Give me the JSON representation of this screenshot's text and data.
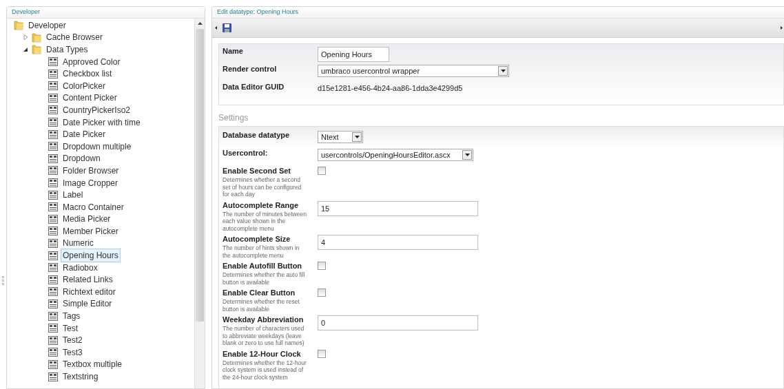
{
  "left_panel": {
    "title": "Developer",
    "tree": [
      {
        "label": "Developer",
        "kind": "folder",
        "selected": false,
        "children": [
          {
            "label": "Cache Browser",
            "kind": "folder",
            "expanded": false,
            "selected": false
          },
          {
            "label": "Data Types",
            "kind": "folder",
            "expanded": true,
            "selected": false,
            "children": [
              {
                "label": "Approved Color",
                "kind": "datatype",
                "selected": false
              },
              {
                "label": "Checkbox list",
                "kind": "datatype",
                "selected": false
              },
              {
                "label": "ColorPicker",
                "kind": "datatype",
                "selected": false
              },
              {
                "label": "Content Picker",
                "kind": "datatype",
                "selected": false
              },
              {
                "label": "CountryPickerIso2",
                "kind": "datatype",
                "selected": false
              },
              {
                "label": "Date Picker with time",
                "kind": "datatype",
                "selected": false
              },
              {
                "label": "Date Picker",
                "kind": "datatype",
                "selected": false
              },
              {
                "label": "Dropdown multiple",
                "kind": "datatype",
                "selected": false
              },
              {
                "label": "Dropdown",
                "kind": "datatype",
                "selected": false
              },
              {
                "label": "Folder Browser",
                "kind": "datatype",
                "selected": false
              },
              {
                "label": "Image Cropper",
                "kind": "datatype",
                "selected": false
              },
              {
                "label": "Label",
                "kind": "datatype",
                "selected": false
              },
              {
                "label": "Macro Container",
                "kind": "datatype",
                "selected": false
              },
              {
                "label": "Media Picker",
                "kind": "datatype",
                "selected": false
              },
              {
                "label": "Member Picker",
                "kind": "datatype",
                "selected": false
              },
              {
                "label": "Numeric",
                "kind": "datatype",
                "selected": false
              },
              {
                "label": "Opening Hours",
                "kind": "datatype",
                "selected": true
              },
              {
                "label": "Radiobox",
                "kind": "datatype",
                "selected": false
              },
              {
                "label": "Related Links",
                "kind": "datatype",
                "selected": false
              },
              {
                "label": "Richtext editor",
                "kind": "datatype",
                "selected": false
              },
              {
                "label": "Simple Editor",
                "kind": "datatype",
                "selected": false
              },
              {
                "label": "Tags",
                "kind": "datatype",
                "selected": false
              },
              {
                "label": "Test",
                "kind": "datatype",
                "selected": false
              },
              {
                "label": "Test2",
                "kind": "datatype",
                "selected": false
              },
              {
                "label": "Test3",
                "kind": "datatype",
                "selected": false
              },
              {
                "label": "Textbox multiple",
                "kind": "datatype",
                "selected": false
              },
              {
                "label": "Textstring",
                "kind": "datatype",
                "selected": false
              }
            ]
          }
        ]
      }
    ]
  },
  "editor": {
    "title": "Edit datatype: Opening Hours",
    "general": [
      {
        "label": "Name",
        "kind": "text",
        "value": "Opening Hours"
      },
      {
        "label": "Render control",
        "kind": "select",
        "value": "umbraco usercontrol wrapper"
      },
      {
        "label": "Data Editor GUID",
        "kind": "static",
        "value": "d15e1281-e456-4b24-aa86-1dda3e4299d5"
      }
    ],
    "settings_heading": "Settings",
    "settings": [
      {
        "label": "Database datatype",
        "kind": "select",
        "value": "Ntext"
      },
      {
        "label": "Usercontrol:",
        "kind": "select",
        "value": "usercontrols/OpeningHoursEditor.ascx"
      },
      {
        "label": "Enable Second Set",
        "description": "Determines whether a second set of hours can be configured for each day",
        "kind": "checkbox",
        "checked": false
      },
      {
        "label": "Autocomplete Range",
        "description": "The number of minutes between each value shown in the autocomplete menu",
        "kind": "text",
        "value": "15"
      },
      {
        "label": "Autocomplete Size",
        "description": "The number of hints shown in the autocomplete menu",
        "kind": "text",
        "value": "4"
      },
      {
        "label": "Enable Autofill Button",
        "description": "Determines whether the auto fill button is available",
        "kind": "checkbox",
        "checked": false
      },
      {
        "label": "Enable Clear Button",
        "description": "Determines whether the reset button is available",
        "kind": "checkbox",
        "checked": false
      },
      {
        "label": "Weekday Abbreviation",
        "description": "The number of characters used to abbreviate weekdays (leave blank or zero to use full names)",
        "kind": "text",
        "value": "0"
      },
      {
        "label": "Enable 12-Hour Clock",
        "description": "Determines whether the 12-hour clock system is used instead of the 24-hour clock system",
        "kind": "checkbox",
        "checked": false
      }
    ]
  }
}
